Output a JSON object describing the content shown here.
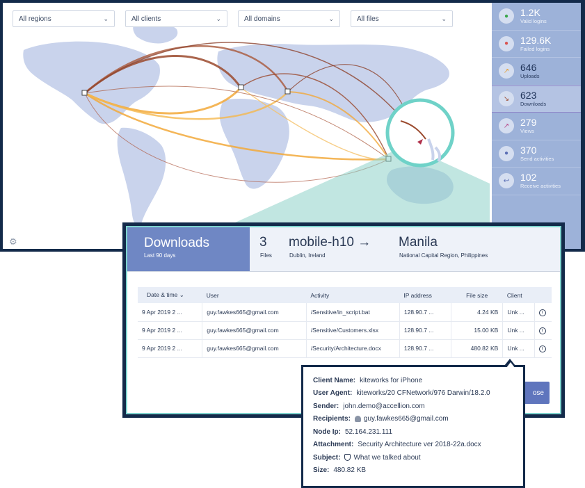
{
  "filters": [
    {
      "label": "All regions"
    },
    {
      "label": "All clients"
    },
    {
      "label": "All domains"
    },
    {
      "label": "All files"
    }
  ],
  "stats": [
    {
      "value": "1.2K",
      "label": "Valid logins",
      "icon": "login-check-icon",
      "color": "#3aa64a"
    },
    {
      "value": "129.6K",
      "label": "Failed logins",
      "icon": "login-fail-icon",
      "color": "#d9534f"
    },
    {
      "value": "646",
      "label": "Uploads",
      "icon": "upload-icon",
      "color": "#e8a23a"
    },
    {
      "value": "623",
      "label": "Downloads",
      "icon": "download-icon",
      "color": "#9b4a2e"
    },
    {
      "value": "279",
      "label": "Views",
      "icon": "view-icon",
      "color": "#b84a8a"
    },
    {
      "value": "370",
      "label": "Send activities",
      "icon": "send-icon",
      "color": "#5b6fb5"
    },
    {
      "value": "102",
      "label": "Receive activities",
      "icon": "receive-icon",
      "color": "#5b6fb5"
    }
  ],
  "modal": {
    "title": "Downloads",
    "subtitle": "Last 90 days",
    "files_count": "3",
    "files_label": "Files",
    "device": "mobile-h10",
    "device_location": "Dublin, Ireland",
    "arrow": "→",
    "destination": "Manila",
    "destination_region": "National Capital Region, Philippines",
    "columns": [
      "Date & time",
      "User",
      "Activity",
      "IP address",
      "File size",
      "Client"
    ],
    "sort_indicator": "⌄",
    "rows": [
      {
        "date": "9 Apr 2019 2 ...",
        "user": "guy.fawkes665@gmail.com",
        "activity": "/Sensitive/in_script.bat",
        "ip": "128.90.7 ...",
        "size": "4.24 KB",
        "client": "Unk ..."
      },
      {
        "date": "9 Apr 2019 2 ...",
        "user": "guy.fawkes665@gmail.com",
        "activity": "/Sensitive/Customers.xlsx",
        "ip": "128.90.7 ...",
        "size": "15.00 KB",
        "client": "Unk ..."
      },
      {
        "date": "9 Apr 2019 2 ...",
        "user": "guy.fawkes665@gmail.com",
        "activity": "/Security/Architecture.docx",
        "ip": "128.90.7 ...",
        "size": "480.82 KB",
        "client": "Unk ..."
      }
    ],
    "close_label": "Close",
    "close_visible": "ose"
  },
  "popover": {
    "client_name_key": "Client Name:",
    "client_name": "kiteworks for iPhone",
    "user_agent_key": "User Agent:",
    "user_agent": "kiteworks/20 CFNetwork/976 Darwin/18.2.0",
    "sender_key": "Sender:",
    "sender": "john.demo@accellion.com",
    "recipients_key": "Recipients:",
    "recipients": "guy.fawkes665@gmail.com",
    "node_ip_key": "Node Ip:",
    "node_ip": "52.164.231.111",
    "attachment_key": "Attachment:",
    "attachment": "Security Architecture ver 2018-22a.docx",
    "subject_key": "Subject:",
    "subject": "What we talked about",
    "size_key": "Size:",
    "size": "480.82 KB"
  },
  "colors": {
    "accent": "#6f87c4",
    "teal": "#7fd4cf",
    "frame": "#132a4a",
    "stat_panel": "#9db2d9",
    "download_arc": "#9b4a2e",
    "upload_arc": "#f2a93b"
  }
}
